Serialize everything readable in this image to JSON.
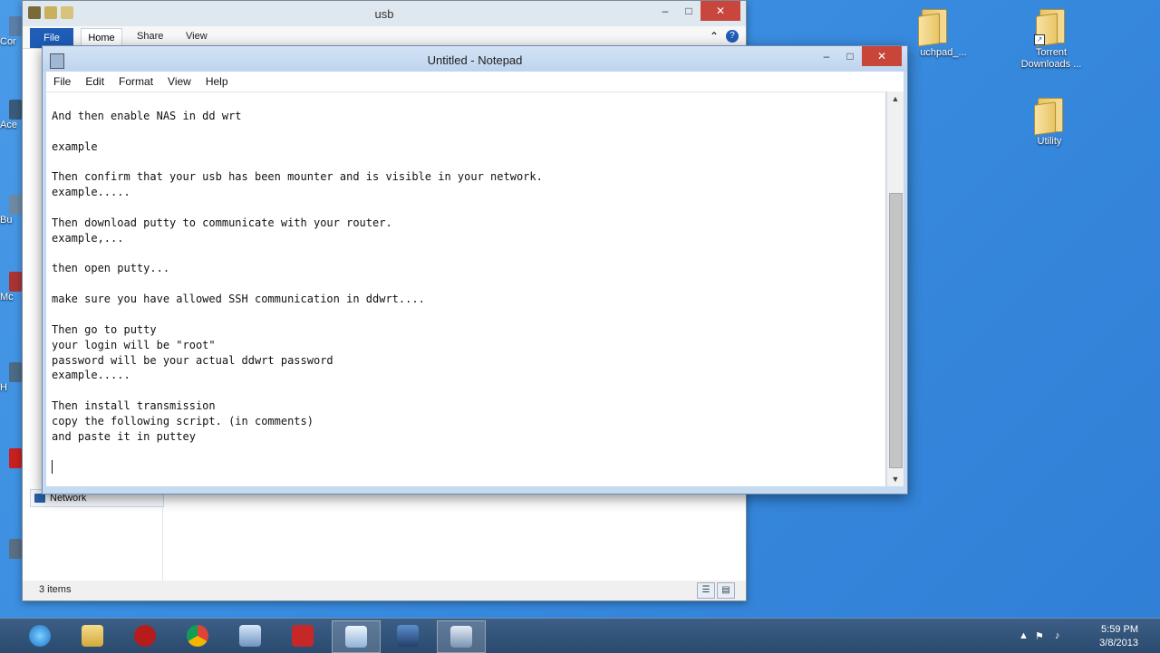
{
  "explorer": {
    "title": "usb",
    "tabs": {
      "file": "File",
      "home": "Home",
      "share": "Share",
      "view": "View"
    },
    "nav_network": "Network",
    "status_items": "3 items"
  },
  "notepad": {
    "title": "Untitled - Notepad",
    "menu": {
      "file": "File",
      "edit": "Edit",
      "format": "Format",
      "view": "View",
      "help": "Help"
    },
    "text": "And then enable NAS in dd wrt\n\nexample\n\nThen confirm that your usb has been mounter and is visible in your network.\nexample.....\n\nThen download putty to communicate with your router.\nexample,...\n\nthen open putty...\n\nmake sure you have allowed SSH communication in ddwrt....\n\nThen go to putty\nyour login will be \"root\"\npassword will be your actual ddwrt password\nexample.....\n\nThen install transmission\ncopy the following script. (in comments)\nand paste it in puttey\n\n"
  },
  "desktop_icons": {
    "touchpad": "uchpad_...",
    "torrent": "Torrent Downloads ...",
    "utility": "Utility"
  },
  "window_controls": {
    "minimize": "–",
    "maximize": "□",
    "close": "✕"
  },
  "taskbar": {
    "apps": [
      "internet-explorer",
      "file-explorer",
      "power",
      "chrome",
      "network-tool",
      "mcafee",
      "notepad",
      "remote-desktop",
      "floppy"
    ],
    "time": "5:59 PM",
    "date": "3/8/2013"
  }
}
